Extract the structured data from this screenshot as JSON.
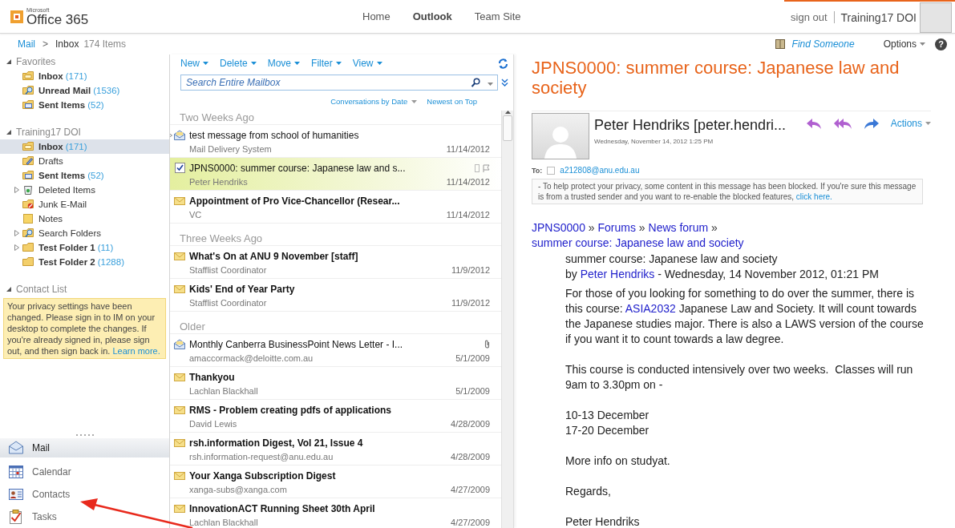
{
  "header": {
    "logo_small": "Microsoft",
    "logo": "Office 365",
    "nav": [
      {
        "label": "Home",
        "selected": false
      },
      {
        "label": "Outlook",
        "selected": true
      },
      {
        "label": "Team Site",
        "selected": false
      }
    ],
    "sign_out": "sign out",
    "user_name": "Training17 DOI"
  },
  "breadcrumb": {
    "root": "Mail",
    "separator": ">",
    "current": "Inbox",
    "count": "174 Items",
    "find_someone": "Find Someone",
    "options": "Options",
    "help": "?"
  },
  "folders": [
    {
      "title": "Favorites",
      "expanded": true,
      "items": [
        {
          "kind": "inbox",
          "name": "Inbox",
          "count": "(171)",
          "unread": true,
          "selected": false,
          "expandable": false
        },
        {
          "kind": "search",
          "name": "Unread Mail",
          "count": "(1536)",
          "unread": true,
          "selected": false,
          "expandable": false
        },
        {
          "kind": "sent",
          "name": "Sent Items",
          "count": "(52)",
          "unread": true,
          "selected": false,
          "expandable": false
        }
      ]
    },
    {
      "title": "Training17 DOI",
      "expanded": true,
      "items": [
        {
          "kind": "inbox",
          "name": "Inbox",
          "count": "(171)",
          "unread": true,
          "selected": true,
          "expandable": false
        },
        {
          "kind": "drafts",
          "name": "Drafts",
          "unread": false,
          "selected": false,
          "expandable": false
        },
        {
          "kind": "sent",
          "name": "Sent Items",
          "count": "(52)",
          "unread": true,
          "selected": false,
          "expandable": false
        },
        {
          "kind": "deleted",
          "name": "Deleted Items",
          "unread": false,
          "selected": false,
          "expandable": true
        },
        {
          "kind": "junk",
          "name": "Junk E-Mail",
          "unread": false,
          "selected": false,
          "expandable": false
        },
        {
          "kind": "notes",
          "name": "Notes",
          "unread": false,
          "selected": false,
          "expandable": false
        },
        {
          "kind": "search",
          "name": "Search Folders",
          "unread": false,
          "selected": false,
          "expandable": true
        },
        {
          "kind": "folder",
          "name": "Test Folder 1",
          "count": "(11)",
          "unread": true,
          "selected": false,
          "expandable": true
        },
        {
          "kind": "folder",
          "name": "Test Folder 2",
          "count": "(1288)",
          "unread": true,
          "selected": false,
          "expandable": false
        }
      ]
    }
  ],
  "contact_list": {
    "title": "Contact List",
    "expanded": true,
    "notice": "Your privacy settings have been changed. Please sign in to IM on your desktop to complete the changes. If you're already signed in, please sign out, and then sign back in.",
    "notice_link": "Learn more."
  },
  "modules": [
    {
      "kind": "mail",
      "label": "Mail",
      "selected": true
    },
    {
      "kind": "calendar",
      "label": "Calendar",
      "selected": false
    },
    {
      "kind": "contacts",
      "label": "Contacts",
      "selected": false
    },
    {
      "kind": "tasks",
      "label": "Tasks",
      "selected": false
    }
  ],
  "toolbar": [
    "New",
    "Delete",
    "Move",
    "Filter",
    "View"
  ],
  "search": {
    "placeholder": "Search Entire Mailbox"
  },
  "sort": {
    "arrange": "Conversations by Date",
    "order": "Newest on Top"
  },
  "groups": [
    {
      "title": "Two Weeks Ago",
      "messages": [
        {
          "kind": "receipt",
          "subject": "test message from school of humanities",
          "sender": "Mail Delivery System",
          "date": "11/14/2012",
          "unread": false,
          "selected": false,
          "expandable": true,
          "attachment": false
        },
        {
          "kind": "task",
          "subject": "JPNS0000: summer course: Japanese law and s...",
          "sender": "Peter Hendriks",
          "date": "11/14/2012",
          "unread": false,
          "selected": true,
          "expandable": false,
          "attachment": false
        },
        {
          "kind": "mail",
          "subject": "Appointment of Pro Vice-Chancellor (Resear...",
          "sender": "VC",
          "date": "11/14/2012",
          "unread": true,
          "selected": false,
          "expandable": false,
          "attachment": false
        }
      ]
    },
    {
      "title": "Three Weeks Ago",
      "messages": [
        {
          "kind": "mail",
          "subject": "What's On at ANU 9 November [staff]",
          "sender": "Stafflist Coordinator",
          "date": "11/9/2012",
          "unread": true,
          "selected": false,
          "expandable": false,
          "attachment": false
        },
        {
          "kind": "mail",
          "subject": "Kids' End of Year Party",
          "sender": "Stafflist Coordinator",
          "date": "11/9/2012",
          "unread": true,
          "selected": false,
          "expandable": false,
          "attachment": false
        }
      ]
    },
    {
      "title": "Older",
      "messages": [
        {
          "kind": "receipt",
          "subject": "Monthly Canberra BusinessPoint News Letter - I...",
          "sender": "amaccormack@deloitte.com.au",
          "date": "5/1/2009",
          "unread": false,
          "selected": false,
          "expandable": false,
          "attachment": true
        },
        {
          "kind": "mail",
          "subject": "Thankyou",
          "sender": "Lachlan Blackhall",
          "date": "5/1/2009",
          "unread": true,
          "selected": false,
          "expandable": false,
          "attachment": false
        },
        {
          "kind": "mail",
          "subject": "RMS - Problem creating pdfs of applications",
          "sender": "David Lewis",
          "date": "4/28/2009",
          "unread": true,
          "selected": false,
          "expandable": false,
          "attachment": false
        },
        {
          "kind": "mail",
          "subject": "rsh.information Digest, Vol 21, Issue 4",
          "sender": "rsh.information-request@anu.edu.au",
          "date": "4/28/2009",
          "unread": true,
          "selected": false,
          "expandable": false,
          "attachment": false
        },
        {
          "kind": "mail",
          "subject": "Your Xanga Subscription Digest",
          "sender": "xanga-subs@xanga.com",
          "date": "4/27/2009",
          "unread": true,
          "selected": false,
          "expandable": false,
          "attachment": false
        },
        {
          "kind": "mail",
          "subject": "InnovationACT Running Sheet 30th April",
          "sender": "Lachlan Blackhall",
          "date": "4/27/2009",
          "unread": true,
          "selected": false,
          "expandable": false,
          "attachment": false
        }
      ]
    }
  ],
  "reading": {
    "subject": "JPNS0000: summer course: Japanese law and society",
    "sender": "Peter Hendriks [peter.hendri...",
    "sent": "Wednesday, November 14, 2012 1:25 PM",
    "actions": "Actions",
    "to_label": "To:",
    "to_checked": false,
    "to": "a212808@anu.edu.au",
    "notice": "- To help protect your privacy, some content in this message has been blocked. If you're sure this message is from a trusted sender and you want to re-enable the blocked features,",
    "notice_link": "click here.",
    "trail": [
      "JPNS0000",
      "Forums",
      "News forum",
      "summer course: Japanese law and society"
    ],
    "trail_separator": "»",
    "post_title": "summer course: Japanese law and society",
    "by": "by",
    "author": "Peter Hendriks",
    "post_date": "- Wednesday, 14 November 2012, 01:21 PM",
    "intro_before": "For those of you looking for something to do over the summer, there is this course:",
    "intro_link": "ASIA2032",
    "intro_after": "Japanese Law and Society. It will count towards the Japanese studies major. There is also a LAWS version of the course if you want it to count towards a law degree.",
    "paragraphs": [
      [
        "This course is conducted intensively over two weeks.  Classes will run 9am to 3.30pm on -"
      ],
      [
        "10-13 December",
        "17-20 December"
      ],
      [
        "More info on studyat."
      ],
      [
        "Regards,"
      ],
      [
        "Peter Hendriks"
      ]
    ]
  }
}
